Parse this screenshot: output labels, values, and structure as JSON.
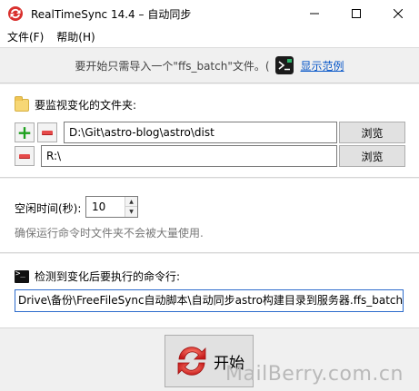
{
  "window": {
    "title": "RealTimeSync 14.4 – 自动同步"
  },
  "menu": {
    "items": [
      {
        "label": "文件(F)"
      },
      {
        "label": "帮助(H)"
      }
    ]
  },
  "hint": {
    "text": "要开始只需导入一个\"ffs_batch\"文件。(",
    "link": "显示范例"
  },
  "folders": {
    "title": "要监视变化的文件夹:",
    "rows": [
      {
        "path": "D:\\Git\\astro-blog\\astro\\dist",
        "browse_label": "浏览"
      },
      {
        "path": "R:\\",
        "browse_label": "浏览"
      }
    ]
  },
  "idle": {
    "label": "空闲时间(秒):",
    "value": "10",
    "description": "确保运行命令时文件夹不会被大量使用."
  },
  "command": {
    "title": "检测到变化后要执行的命令行:",
    "value": "Drive\\备份\\FreeFileSync自动脚本\\自动同步astro构建目录到服务器.ffs_batch\""
  },
  "start": {
    "label": "开始"
  },
  "watermark": {
    "text": "MailBerry.com.cn"
  }
}
